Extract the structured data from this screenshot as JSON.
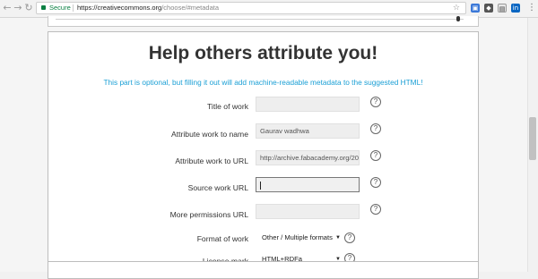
{
  "browser": {
    "secure_label": "Secure",
    "url_host": "https://creativecommons.org",
    "url_path": "/choose/#metadata",
    "back_icon": "back-arrow-icon",
    "forward_icon": "forward-arrow-icon",
    "reload_icon": "reload-icon"
  },
  "card": {
    "title": "Help others attribute you!",
    "subtitle": "This part is optional, but filling it out will add machine-readable metadata to the suggested HTML!",
    "accent_color": "#1a9fd5"
  },
  "fields": {
    "title_of_work": {
      "label": "Title of work",
      "value": ""
    },
    "attribute_name": {
      "label": "Attribute work to name",
      "value": "Gaurav wadhwa"
    },
    "attribute_url": {
      "label": "Attribute work to URL",
      "value": "http://archive.fabacademy.org/2018/"
    },
    "source_url": {
      "label": "Source work URL",
      "value": ""
    },
    "more_permissions": {
      "label": "More permissions URL",
      "value": ""
    },
    "format_of_work": {
      "label": "Format of work",
      "value": "Other / Multiple formats"
    },
    "license_mark": {
      "label": "License mark",
      "value": "HTML+RDFa"
    }
  },
  "help_symbol": "?"
}
